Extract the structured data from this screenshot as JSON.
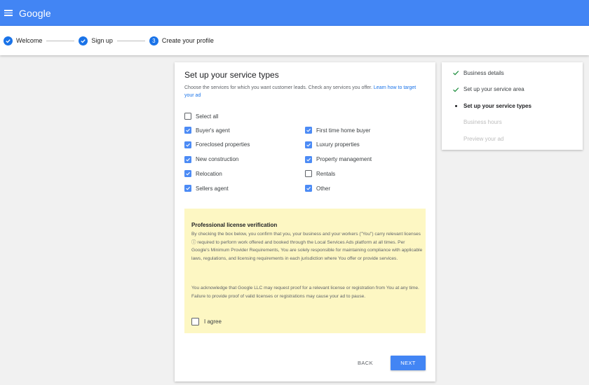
{
  "header": {
    "brand": "Google",
    "colors": {
      "topbar": "#4285f4",
      "accent": "#1a73e8"
    }
  },
  "stepper": {
    "steps": [
      {
        "label": "Welcome",
        "state": "done"
      },
      {
        "label": "Sign up",
        "state": "done"
      },
      {
        "label": "Create your profile",
        "state": "current",
        "number": "3"
      }
    ]
  },
  "main": {
    "title": "Set up your service types",
    "description": "Choose the services for which you want customer leads. Check any services you offer.",
    "description_link": "Learn how to target your ad",
    "select_all": {
      "label": "Select all",
      "checked": false
    },
    "services": [
      {
        "label": "Buyer's agent",
        "checked": true
      },
      {
        "label": "First time home buyer",
        "checked": true
      },
      {
        "label": "Foreclosed properties",
        "checked": true
      },
      {
        "label": "Luxury properties",
        "checked": true
      },
      {
        "label": "New construction",
        "checked": true
      },
      {
        "label": "Property management",
        "checked": true
      },
      {
        "label": "Relocation",
        "checked": true
      },
      {
        "label": "Rentals",
        "checked": false
      },
      {
        "label": "Sellers agent",
        "checked": true
      },
      {
        "label": "Other",
        "checked": true
      }
    ],
    "license": {
      "title": "Professional license verification",
      "paragraph1": "By checking the box below, you confirm that you, your business and your workers (\"You\") carry relevant licenses ⓘ required to perform work offered and booked through the Local Services Ads platform at all times. Per Google's Minimum Provider Requirements, You are solely responsible for maintaining compliance with applicable laws, regulations, and licensing requirements in each jurisdiction where You offer or provide services.",
      "paragraph2": "You acknowledge that Google LLC may request proof for a relevant license or registration from You at any time. Failure to provide proof of valid licenses or registrations may cause your ad to pause.",
      "agree_label": "I agree",
      "agree_checked": false,
      "background": "#fdf7c3"
    },
    "buttons": {
      "back": "BACK",
      "next": "NEXT"
    }
  },
  "progress": {
    "items": [
      {
        "label": "Business details",
        "state": "done"
      },
      {
        "label": "Set up your service area",
        "state": "done"
      },
      {
        "label": "Set up your service types",
        "state": "current"
      },
      {
        "label": "Business hours",
        "state": "pending"
      },
      {
        "label": "Preview your ad",
        "state": "pending"
      }
    ]
  },
  "icons": {
    "menu": "hamburger-icon",
    "step_done": "check-circle-icon",
    "checkbox_checked": "checkbox-checked-icon",
    "checkbox_unchecked": "checkbox-unchecked-icon",
    "progress_done": "check-icon",
    "progress_current": "dot-icon"
  }
}
